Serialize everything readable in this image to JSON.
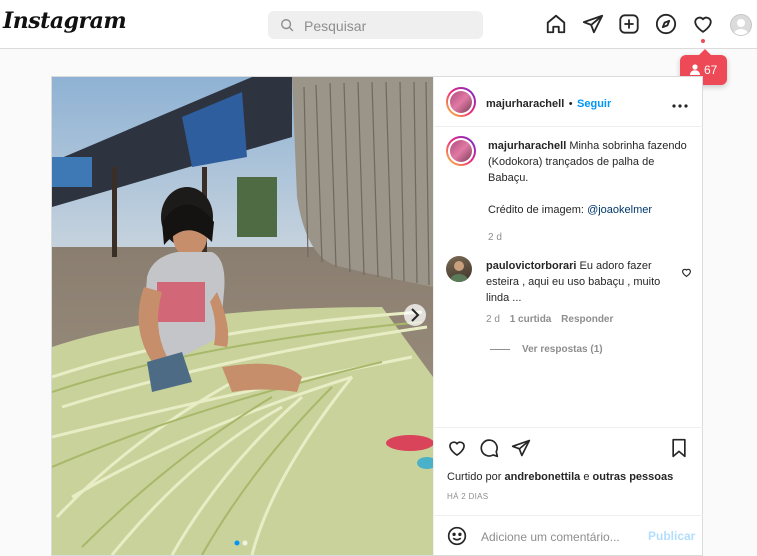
{
  "header": {
    "logo": "Instagram",
    "search_placeholder": "Pesquisar",
    "notifications_count": "67"
  },
  "post": {
    "author": "majurharachell",
    "separator": "•",
    "follow_label": "Seguir",
    "caption_text": "Minha sobrinha fazendo (Kodokora) trançados de palha de Babaçu.",
    "credit_label": "Crédito de imagem:",
    "credit_mention": "@joaokelmer",
    "caption_time": "2 d",
    "comment": {
      "author": "paulovictorborari",
      "text": "Eu adoro fazer esteira , aqui eu uso babaçu , muito linda ...",
      "time": "2 d",
      "likes": "1 curtida",
      "reply_label": "Responder",
      "view_replies": "Ver respostas (1)"
    },
    "liked_prefix": "Curtido por",
    "liked_user": "andrebonettila",
    "liked_suffix": "e",
    "liked_others": "outras pessoas",
    "time_ago": "HÁ 2 DIAS",
    "comment_placeholder": "Adicione um comentário...",
    "publish_label": "Publicar"
  },
  "colors": {
    "accent": "#0095f6",
    "notification": "#ed4956",
    "publish_disabled": "#b2dffc"
  }
}
